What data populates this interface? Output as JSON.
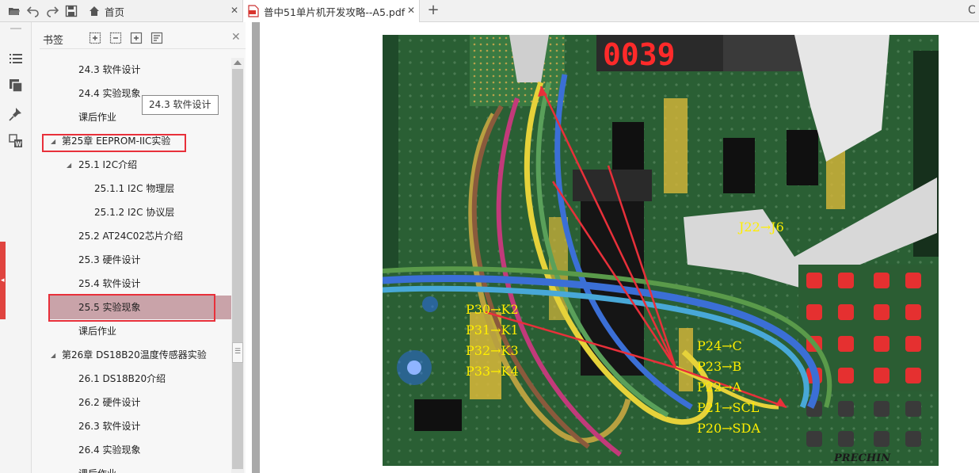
{
  "toolbar": {
    "icons": [
      "folder-open-icon",
      "undo-icon",
      "redo-icon",
      "save-icon"
    ]
  },
  "tabs": [
    {
      "label": "首页",
      "icon": "home-icon",
      "active": false
    },
    {
      "label": "普中51单片机开发攻略--A5.pdf",
      "icon": "pdf-icon",
      "active": true
    }
  ],
  "panel": {
    "title": "书签",
    "header_icons": [
      "expand-all-icon",
      "collapse-all-icon",
      "add-bookmark-icon",
      "bookmark-properties-icon"
    ]
  },
  "bookmarks": [
    {
      "label": "24.3 软件设计",
      "level": 1
    },
    {
      "label": "24.4 实验现象",
      "level": 1
    },
    {
      "label": "课后作业",
      "level": 1
    },
    {
      "label": "第25章 EEPROM-IIC实验",
      "level": 0,
      "expanded": true
    },
    {
      "label": "25.1 I2C介绍",
      "level": 1,
      "expanded": true
    },
    {
      "label": "25.1.1 I2C 物理层",
      "level": 2
    },
    {
      "label": "25.1.2 I2C 协议层",
      "level": 2
    },
    {
      "label": "25.2 AT24C02芯片介绍",
      "level": 1
    },
    {
      "label": "25.3 硬件设计",
      "level": 1
    },
    {
      "label": "25.4 软件设计",
      "level": 1
    },
    {
      "label": "25.5 实验现象",
      "level": 1,
      "selected": true
    },
    {
      "label": "课后作业",
      "level": 1
    },
    {
      "label": "第26章 DS18B20温度传感器实验",
      "level": 0,
      "expanded": true
    },
    {
      "label": "26.1 DS18B20介绍",
      "level": 1
    },
    {
      "label": "26.2 硬件设计",
      "level": 1
    },
    {
      "label": "26.3 软件设计",
      "level": 1
    },
    {
      "label": "26.4 实验现象",
      "level": 1
    },
    {
      "label": "课后作业",
      "level": 1
    }
  ],
  "tooltip": "24.3 软件设计",
  "photo_labels": {
    "left": [
      "P30→K2",
      "P31→K1",
      "P32→K3",
      "P33→K4"
    ],
    "right": [
      "P24→C",
      "P23→B",
      "P22→A",
      "P21→SCL",
      "P20→SDA"
    ],
    "ribbon": "J22→J6",
    "brand": "PRECHIN"
  },
  "colors": {
    "selection": "#c9a3a9",
    "highlight_box": "#e8303a",
    "accent_left": "#e0443f",
    "board_green": "#2f6b3a",
    "label_yellow": "#ffee00"
  }
}
